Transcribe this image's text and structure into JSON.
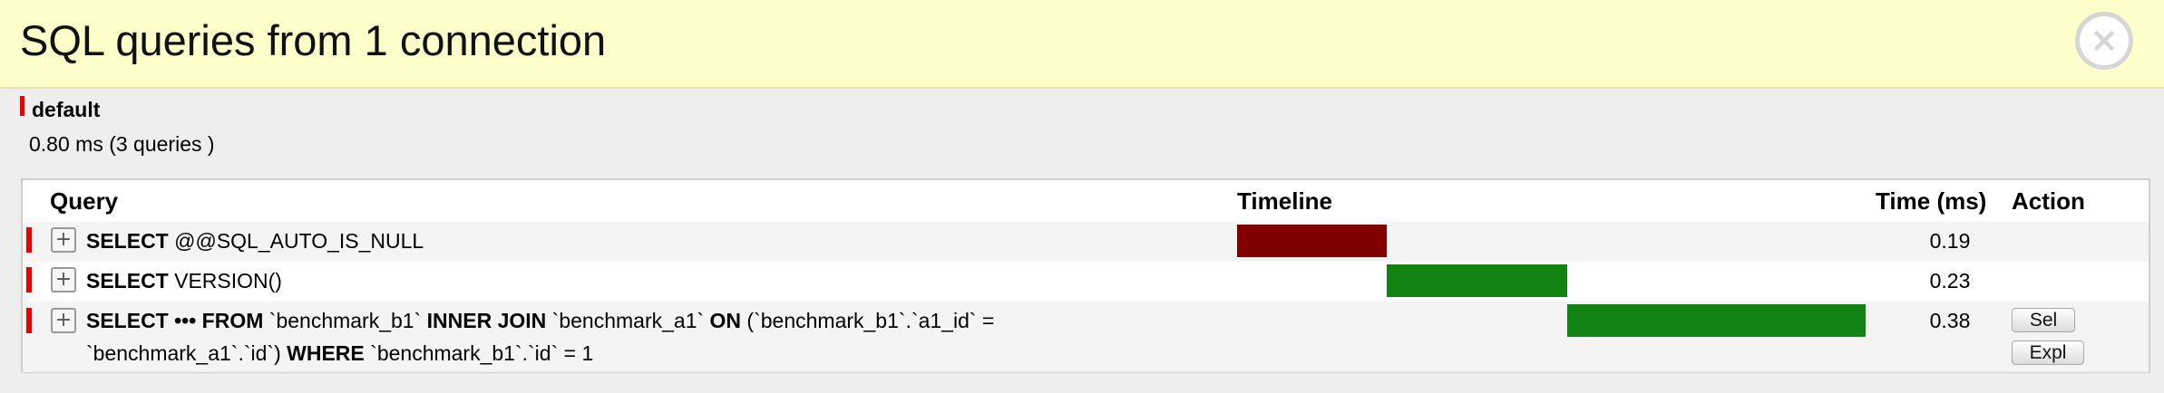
{
  "panel": {
    "title": "SQL queries from 1 connection",
    "close_icon": "×"
  },
  "connection": {
    "name": "default",
    "summary": "0.80 ms (3 queries )"
  },
  "table": {
    "headers": {
      "query": "Query",
      "timeline": "Timeline",
      "time": "Time (ms)",
      "action": "Action"
    }
  },
  "queries": [
    {
      "expand_symbol": "+",
      "keyword1": "SELECT",
      "text1": " @@SQL_AUTO_IS_NULL",
      "time_ms": "0.19",
      "timeline_start_pct": 0,
      "timeline_width_pct": 23.75,
      "bar_color": "#800000"
    },
    {
      "expand_symbol": "+",
      "keyword1": "SELECT",
      "text1": " VERSION()",
      "time_ms": "0.23",
      "timeline_start_pct": 23.75,
      "timeline_width_pct": 28.75,
      "bar_color": "#128212"
    },
    {
      "expand_symbol": "+",
      "keyword1": "SELECT ••• FROM",
      "text1": " `benchmark_b1` ",
      "keyword2": "INNER JOIN",
      "text2": " `benchmark_a1` ",
      "keyword3": "ON",
      "text3": " (`benchmark_b1`.`a1_id` =",
      "text4": "`benchmark_a1`.`id`) ",
      "keyword4": "WHERE",
      "text5": " `benchmark_b1`.`id` = 1",
      "time_ms": "0.38",
      "timeline_start_pct": 52.5,
      "timeline_width_pct": 47.5,
      "bar_color": "#128212",
      "actions": {
        "sel": "Sel",
        "expl": "Expl"
      }
    }
  ]
}
